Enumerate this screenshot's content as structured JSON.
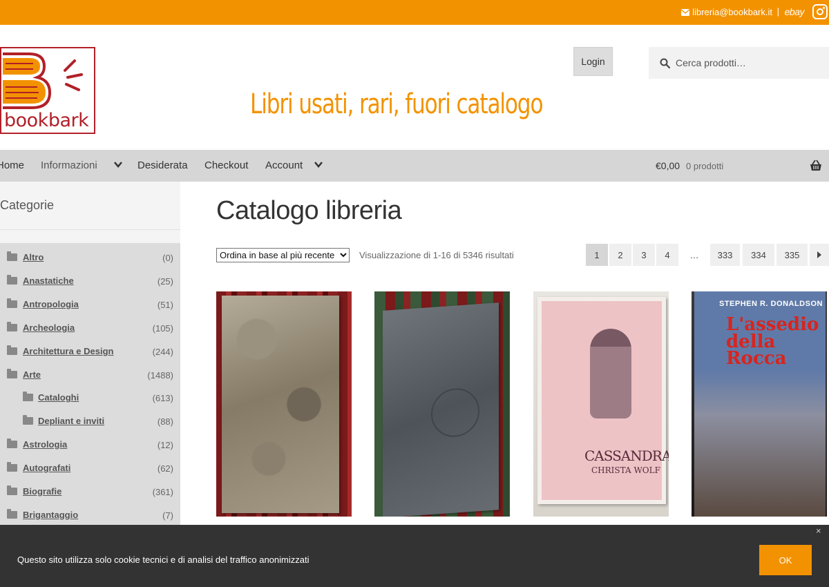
{
  "colors": {
    "brand": "#f39200",
    "logo_red": "#b22028",
    "cookie_bg": "#333333"
  },
  "topbar": {
    "email": "libreria@bookbark.it",
    "separator": "|",
    "ebay": "ebay",
    "email_icon": "envelope-icon",
    "instagram_icon": "instagram-icon"
  },
  "header": {
    "logo_text": "bookbark",
    "tagline": "Libri usati, rari, fuori catalogo",
    "login": "Login",
    "search_placeholder": "Cerca prodotti…",
    "search_icon": "magnifier-icon"
  },
  "nav": {
    "items": [
      {
        "label": "Home"
      },
      {
        "label": "Informazioni"
      },
      {
        "label": "Desiderata"
      },
      {
        "label": "Checkout"
      },
      {
        "label": "Account"
      }
    ],
    "cart": {
      "total": "€0,00",
      "count": "0 prodotti",
      "icon": "basket-icon"
    }
  },
  "sidebar": {
    "title": "Categorie",
    "categories": [
      {
        "name": "Altro",
        "count": "(0)"
      },
      {
        "name": "Anastatiche",
        "count": "(25)"
      },
      {
        "name": "Antropologia",
        "count": "(51)"
      },
      {
        "name": "Archeologia",
        "count": "(105)"
      },
      {
        "name": "Architettura e Design",
        "count": "(244)"
      },
      {
        "name": "Arte",
        "count": "(1488)"
      },
      {
        "name": "Cataloghi",
        "count": "(613)"
      },
      {
        "name": "Depliant e inviti",
        "count": "(88)"
      },
      {
        "name": "Astrologia",
        "count": "(12)"
      },
      {
        "name": "Autografati",
        "count": "(62)"
      },
      {
        "name": "Biografie",
        "count": "(361)"
      },
      {
        "name": "Brigantaggio",
        "count": "(7)"
      }
    ]
  },
  "main": {
    "title": "Catalogo libreria",
    "orderby": "Ordina in base al più recente",
    "results": "Visualizzazione di 1-16 di 5346 risultati",
    "pages": [
      "1",
      "2",
      "3",
      "4",
      "…",
      "333",
      "334",
      "335"
    ],
    "next_icon": "arrow-right-icon",
    "products": [
      {
        "cover_text": ""
      },
      {
        "cover_text": ""
      },
      {
        "cover_title": "CASSANDRA",
        "cover_author": "CHRISTA WOLF"
      },
      {
        "cover_author": "STEPHEN R. DONALDSON",
        "cover_title": "L'assedio della Rocca"
      }
    ]
  },
  "cookie": {
    "message": "Questo sito utilizza solo cookie tecnici e di analisi del traffico anonimizzati",
    "ok": "OK",
    "close": "×"
  }
}
